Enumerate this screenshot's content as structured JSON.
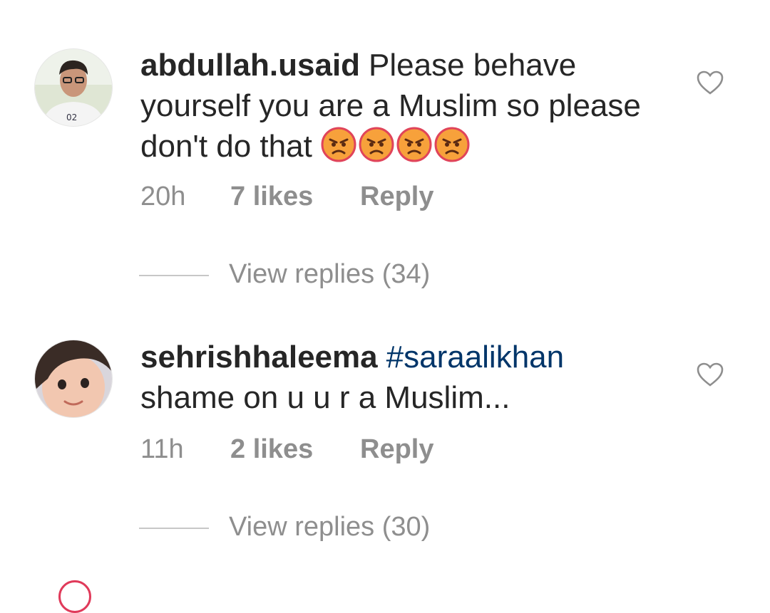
{
  "comments": [
    {
      "username": "abdullah.usaid",
      "text": "Please behave yourself you are a Muslim so please don't do that",
      "emoji_icons": [
        "angry-face-icon",
        "angry-face-icon",
        "angry-face-icon",
        "angry-face-icon"
      ],
      "time": "20h",
      "likes": "7 likes",
      "reply": "Reply",
      "view_replies": "View replies (34)"
    },
    {
      "username": "sehrishhaleema",
      "hashtag": "#saraalikhan",
      "text": "shame on u u r a Muslim...",
      "time": "11h",
      "likes": "2 likes",
      "reply": "Reply",
      "view_replies": "View replies (30)"
    }
  ],
  "colors": {
    "text": "#262626",
    "meta": "#8e8e8e",
    "hashtag": "#003569",
    "emoji_face": "#f7a13b",
    "emoji_rim": "#e0445a"
  }
}
